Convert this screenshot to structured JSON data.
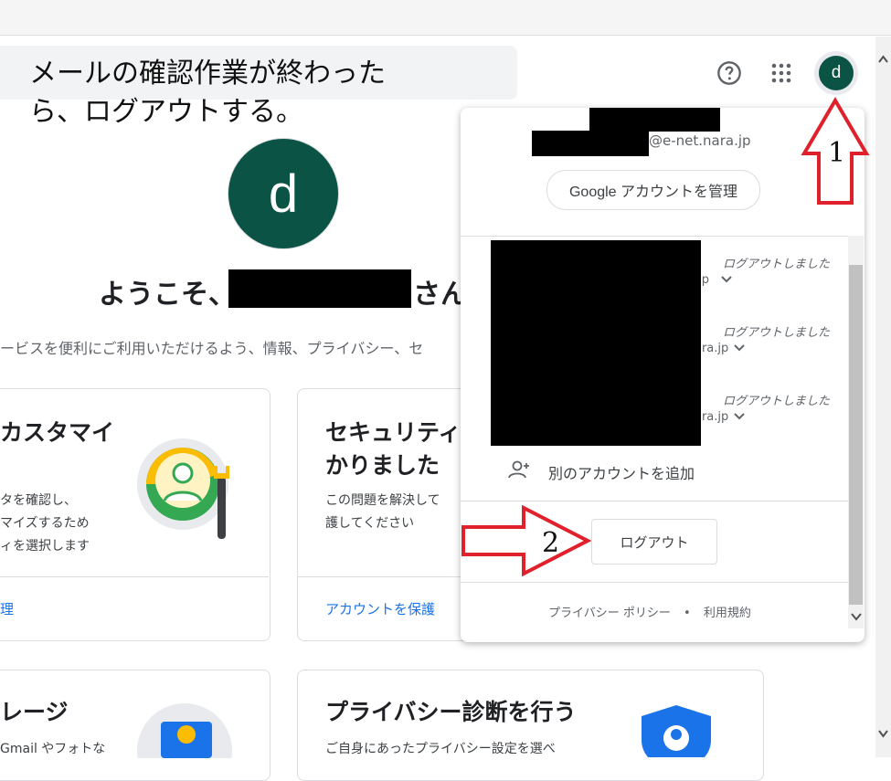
{
  "caption": {
    "line1": "メールの確認作業が終わった",
    "line2": "ら、ログアウトする。"
  },
  "header": {
    "help_icon": "help-icon",
    "apps_icon": "apps-grid-icon",
    "avatar_letter": "d"
  },
  "profile": {
    "avatar_letter": "d",
    "welcome_prefix": "ようこそ、s",
    "welcome_suffix": "さん",
    "subtext": "ービスを便利にご利用いただけるよう、情報、プライバシー、セ"
  },
  "cards": [
    {
      "title_line1": "カスタマイ",
      "title_line2": "",
      "desc": [
        "タを確認し、",
        "マイズするため",
        "ィを選択します"
      ],
      "link": "理"
    },
    {
      "title_line1": "セキュリティの",
      "title_line2": "かりました",
      "desc": [
        "この問題を解決して",
        "護してください"
      ],
      "link": "アカウントを保護"
    },
    {
      "title_line1": "レージ",
      "desc": [
        "Gmail やフォトな"
      ]
    },
    {
      "title_line1": "プライバシー診断を行う",
      "desc": [
        "ご自身にあったプライバシー設定を選べ"
      ]
    }
  ],
  "account_panel": {
    "email_suffix": "@e-net.nara.jp",
    "manage_button": "Google アカウントを管理",
    "accounts": [
      {
        "status": "ログアウトしました",
        "email_tail": ".jp"
      },
      {
        "status": "ログアウトしました",
        "email_tail": "ara.jp"
      },
      {
        "status": "ログアウトしました",
        "email_tail": "ara.jp"
      }
    ],
    "add_account": "別のアカウントを追加",
    "logout_button": "ログアウト",
    "footer_privacy": "プライバシー ポリシー",
    "footer_dot": "•",
    "footer_terms": "利用規約"
  },
  "annotations": {
    "step1": "1",
    "step2": "2",
    "arrow_color": "#e0202a"
  },
  "colors": {
    "avatar": "#0b5345",
    "link": "#1a73e8"
  }
}
